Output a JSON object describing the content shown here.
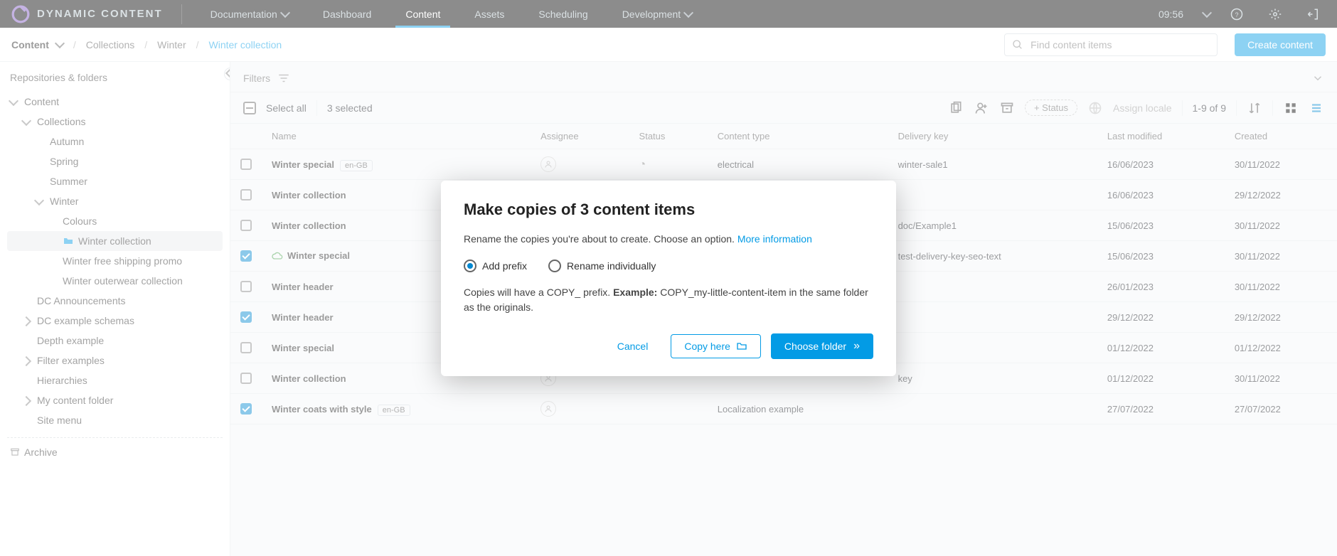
{
  "topbar": {
    "logo_text": "DYNAMIC CONTENT",
    "nav": {
      "documentation": "Documentation",
      "dashboard": "Dashboard",
      "content": "Content",
      "assets": "Assets",
      "scheduling": "Scheduling",
      "development": "Development"
    },
    "clock": "09:56"
  },
  "breadcrumb": {
    "root": "Content",
    "items": [
      "Collections",
      "Winter",
      "Winter collection"
    ],
    "search_placeholder": "Find content items",
    "create_label": "Create content"
  },
  "sidebar": {
    "title": "Repositories & folders",
    "nodes": [
      {
        "label": "Content",
        "indent": 0,
        "expanded": true
      },
      {
        "label": "Collections",
        "indent": 1,
        "expanded": true
      },
      {
        "label": "Autumn",
        "indent": 2,
        "leaf": true
      },
      {
        "label": "Spring",
        "indent": 2,
        "leaf": true
      },
      {
        "label": "Summer",
        "indent": 2,
        "leaf": true
      },
      {
        "label": "Winter",
        "indent": 2,
        "expanded": true
      },
      {
        "label": "Colours",
        "indent": 3,
        "leaf": true
      },
      {
        "label": "Winter collection",
        "indent": 3,
        "leaf": true,
        "selected": true,
        "folderIcon": true
      },
      {
        "label": "Winter free shipping promo",
        "indent": 3,
        "leaf": true
      },
      {
        "label": "Winter outerwear collection",
        "indent": 3,
        "leaf": true
      },
      {
        "label": "DC Announcements",
        "indent": 1,
        "leaf": true
      },
      {
        "label": "DC example schemas",
        "indent": 1,
        "expanded": false
      },
      {
        "label": "Depth example",
        "indent": 1,
        "leaf": true
      },
      {
        "label": "Filter examples",
        "indent": 1,
        "expanded": false
      },
      {
        "label": "Hierarchies",
        "indent": 1,
        "leaf": true
      },
      {
        "label": "My content folder",
        "indent": 1,
        "expanded": false
      },
      {
        "label": "Site menu",
        "indent": 1,
        "leaf": true
      }
    ],
    "archive": "Archive"
  },
  "filters_label": "Filters",
  "actionbar": {
    "select_all": "Select all",
    "selected": "3 selected",
    "add_status": "+ Status",
    "assign_locale": "Assign locale",
    "pager": "1-9 of 9"
  },
  "columns": {
    "name": "Name",
    "assignee": "Assignee",
    "status": "Status",
    "content_type": "Content type",
    "delivery_key": "Delivery key",
    "last_modified": "Last modified",
    "created": "Created"
  },
  "rows": [
    {
      "checked": false,
      "name": "Winter special",
      "locale": "en-GB",
      "cloud": false,
      "status": "partial",
      "content_type": "electrical",
      "delivery_key": "winter-sale1",
      "modified": "16/06/2023",
      "created": "30/11/2022"
    },
    {
      "checked": false,
      "name": "Winter collection",
      "locale": "",
      "cloud": false,
      "status": "",
      "content_type": "",
      "delivery_key": "",
      "modified": "16/06/2023",
      "created": "29/12/2022"
    },
    {
      "checked": false,
      "name": "Winter collection",
      "locale": "",
      "cloud": false,
      "status": "",
      "content_type": "",
      "delivery_key": "doc/Example1",
      "modified": "15/06/2023",
      "created": "30/11/2022"
    },
    {
      "checked": true,
      "name": "Winter special",
      "locale": "",
      "cloud": true,
      "status": "",
      "content_type": "",
      "delivery_key": "test-delivery-key-seo-text",
      "modified": "15/06/2023",
      "created": "30/11/2022"
    },
    {
      "checked": false,
      "name": "Winter header",
      "locale": "",
      "cloud": false,
      "status": "",
      "content_type": "",
      "delivery_key": "",
      "modified": "26/01/2023",
      "created": "30/11/2022"
    },
    {
      "checked": true,
      "name": "Winter header",
      "locale": "",
      "cloud": false,
      "status": "",
      "content_type": "",
      "delivery_key": "",
      "modified": "29/12/2022",
      "created": "29/12/2022"
    },
    {
      "checked": false,
      "name": "Winter special",
      "locale": "",
      "cloud": false,
      "status": "",
      "content_type": "",
      "delivery_key": "",
      "modified": "01/12/2022",
      "created": "01/12/2022"
    },
    {
      "checked": false,
      "name": "Winter collection",
      "locale": "",
      "cloud": false,
      "status": "",
      "content_type": "",
      "delivery_key": "key",
      "modified": "01/12/2022",
      "created": "30/11/2022"
    },
    {
      "checked": true,
      "name": "Winter coats with style",
      "locale": "en-GB",
      "cloud": false,
      "status": "",
      "content_type": "Localization example",
      "delivery_key": "",
      "modified": "27/07/2022",
      "created": "27/07/2022"
    }
  ],
  "modal": {
    "title": "Make copies of 3 content items",
    "body_prefix": "Rename the copies you're about to create. Choose an option. ",
    "more_info": "More information",
    "radio_prefix": "Add prefix",
    "radio_rename": "Rename individually",
    "radio_selected": "prefix",
    "copies_text_a": "Copies will have a COPY_ prefix. ",
    "copies_text_b": "Example:",
    "copies_text_c": " COPY_my-little-content-item in the same folder as the originals.",
    "cancel": "Cancel",
    "copy_here": "Copy here",
    "choose_folder": "Choose folder"
  }
}
